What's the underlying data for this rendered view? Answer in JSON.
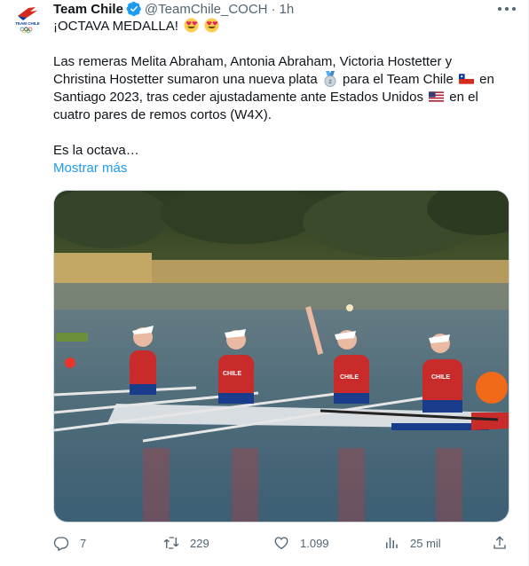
{
  "author": {
    "name": "Team Chile",
    "handle": "@TeamChile_COCH",
    "separator": "·",
    "time": "1h",
    "avatar_icon": "team-chile-logo",
    "verified_icon": "verified-badge-icon"
  },
  "tweet": {
    "line1": "¡OCTAVA MEDALLA!",
    "para2_a": "Las remeras Melita Abraham, Antonia Abraham, Victoria Hostetter y",
    "para2_b": "Christina Hostetter sumaron una nueva plata",
    "para2_c": "para el Team Chile",
    "para2_d": "en",
    "para2_e": "Santiago 2023, tras ceder ajustadamente ante Estados Unidos",
    "para2_f": "en el",
    "para2_g": "cuatro pares de remos cortos (W4X).",
    "para3": "Es la octava…",
    "show_more": "Mostrar más",
    "emojis": [
      "heart-eyes-emoji",
      "heart-eyes-emoji",
      "silver-medal-emoji",
      "chile-flag",
      "usa-flag"
    ]
  },
  "media": {
    "description_icon": "rowing-photo"
  },
  "actions": {
    "replies": "7",
    "retweets": "229",
    "likes": "1.099",
    "views": "25 mil"
  },
  "colors": {
    "accent": "#1d9bf0",
    "text": "#0f1419",
    "secondary": "#536471"
  }
}
